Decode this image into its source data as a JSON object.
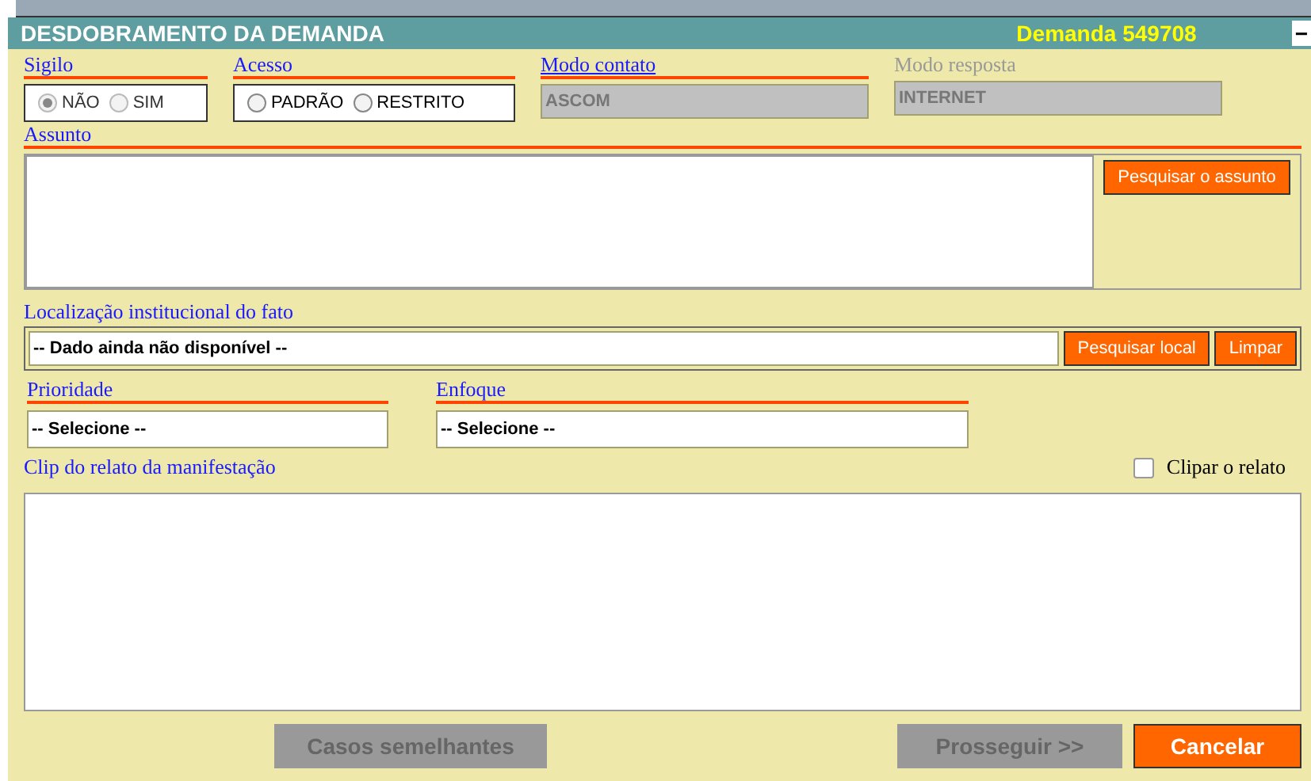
{
  "panel": {
    "title": "DESDOBRAMENTO DA DEMANDA",
    "demand": "Demanda 549708",
    "collapse_symbol": "−"
  },
  "sigilo": {
    "label": "Sigilo",
    "options": [
      {
        "label": "NÃO",
        "selected": true,
        "disabled": true
      },
      {
        "label": "SIM",
        "selected": false,
        "disabled": true
      }
    ]
  },
  "acesso": {
    "label": "Acesso",
    "options": [
      {
        "label": "PADRÃO",
        "selected": false,
        "disabled": false
      },
      {
        "label": "RESTRITO",
        "selected": false,
        "disabled": false
      }
    ]
  },
  "modo_contato": {
    "label": "Modo contato",
    "value": "ASCOM",
    "disabled": false
  },
  "modo_resposta": {
    "label": "Modo resposta",
    "value": "INTERNET",
    "disabled": true
  },
  "assunto": {
    "label": "Assunto",
    "button": "Pesquisar o assunto"
  },
  "localizacao": {
    "label": "Localização institucional do fato",
    "value": "-- Dado ainda não disponível --",
    "search_button": "Pesquisar local",
    "clear_button": "Limpar"
  },
  "prioridade": {
    "label": "Prioridade",
    "value": "-- Selecione --"
  },
  "enfoque": {
    "label": "Enfoque",
    "value": "-- Selecione --"
  },
  "clip": {
    "label": "Clip do relato da manifestação",
    "checkbox_label": "Clipar o relato",
    "checked": false
  },
  "buttons": [
    {
      "label": "Casos semelhantes",
      "disabled": true
    },
    {
      "label": "Prosseguir >>",
      "disabled": true
    },
    {
      "label": "Cancelar",
      "disabled": false
    }
  ]
}
